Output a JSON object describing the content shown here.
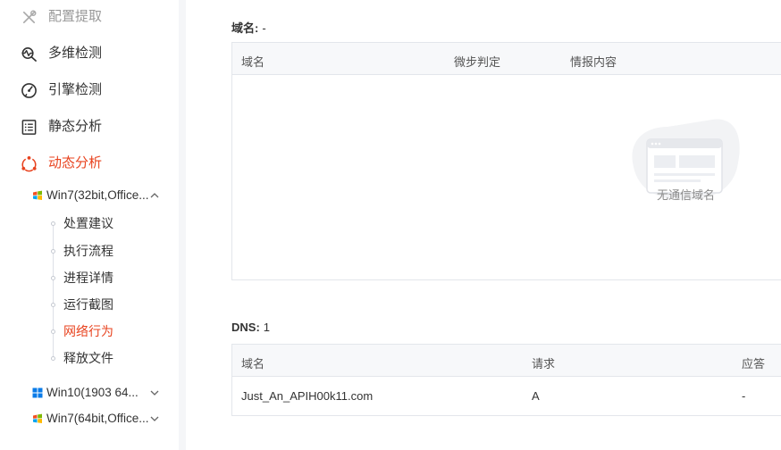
{
  "sidebar": {
    "menu": [
      {
        "label": "配置提取",
        "icon": "tools-icon",
        "state": "disabled"
      },
      {
        "label": "多维检测",
        "icon": "multi-scan-icon",
        "state": "normal"
      },
      {
        "label": "引擎检测",
        "icon": "engine-icon",
        "state": "normal"
      },
      {
        "label": "静态分析",
        "icon": "list-doc-icon",
        "state": "normal"
      },
      {
        "label": "动态分析",
        "icon": "dynamic-analysis-icon",
        "state": "active"
      }
    ],
    "environments": [
      {
        "label": "Win7(32bit,Office...",
        "icon": "windows7-icon",
        "expanded": true
      },
      {
        "label": "Win10(1903 64...",
        "icon": "windows10-icon",
        "expanded": false
      },
      {
        "label": "Win7(64bit,Office...",
        "icon": "windows7-icon",
        "expanded": false
      }
    ],
    "subitems": [
      {
        "label": "处置建议"
      },
      {
        "label": "执行流程"
      },
      {
        "label": "进程详情"
      },
      {
        "label": "运行截图"
      },
      {
        "label": "网络行为",
        "active": true
      },
      {
        "label": "释放文件"
      }
    ]
  },
  "domain_section": {
    "title": "域名",
    "colon": ":",
    "value": "-",
    "columns": [
      "域名",
      "微步判定",
      "情报内容"
    ],
    "empty_text": "无通信域名"
  },
  "dns_section": {
    "title": "DNS",
    "colon": ":",
    "count": "1",
    "columns": [
      "域名",
      "请求",
      "应答"
    ],
    "rows": [
      {
        "domain": "Just_An_APIH00k11.com",
        "request": "A",
        "response": "-"
      }
    ]
  },
  "colors": {
    "accent": "#e8431f",
    "text": "#333333",
    "muted": "#999999",
    "border": "#e3e6eb",
    "header_bg": "#f7f8fa"
  }
}
